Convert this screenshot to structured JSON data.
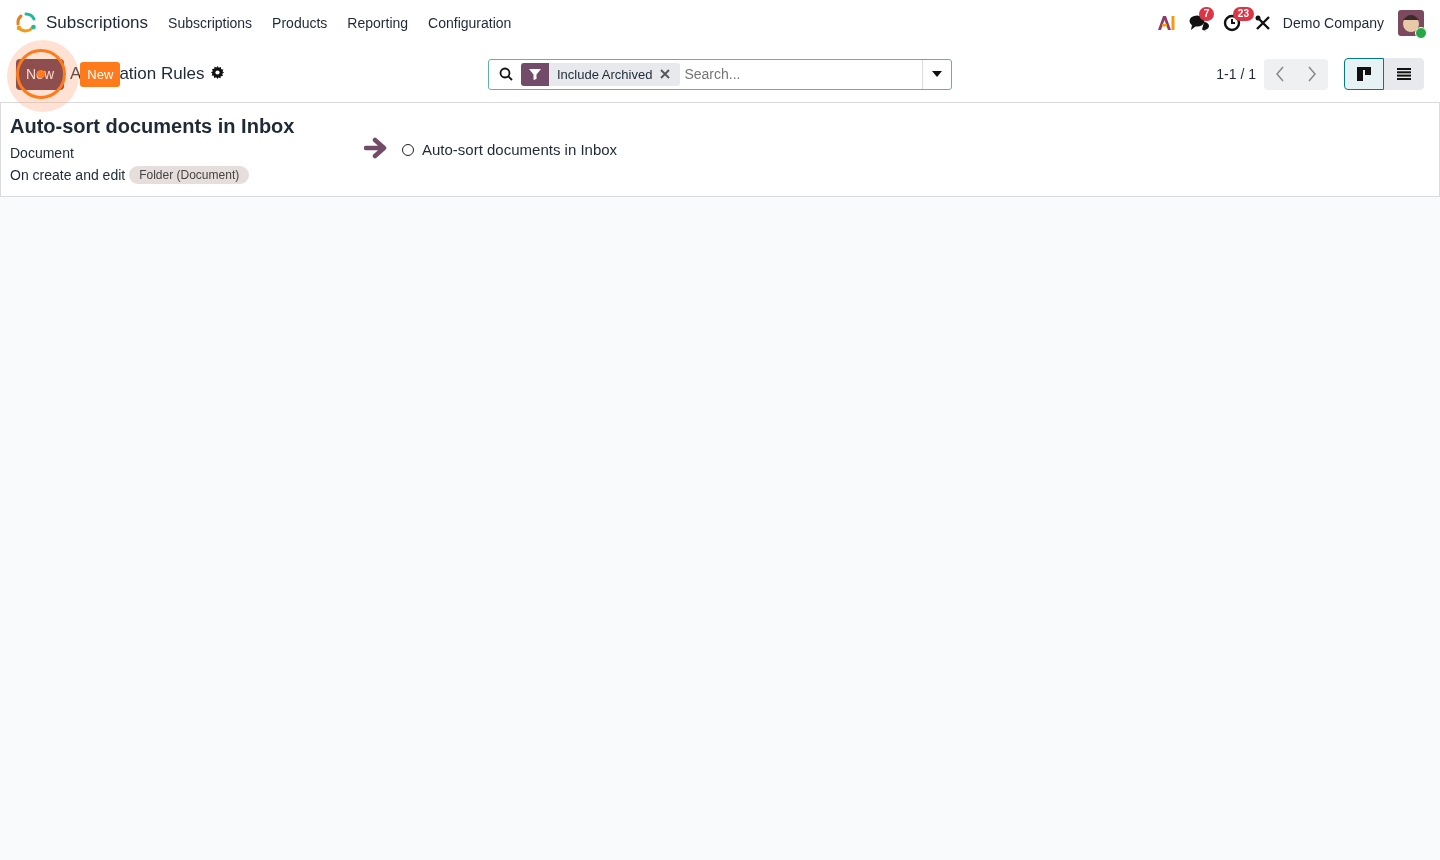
{
  "app": {
    "name": "Subscriptions"
  },
  "menu": [
    {
      "label": "Subscriptions"
    },
    {
      "label": "Products"
    },
    {
      "label": "Reporting"
    },
    {
      "label": "Configuration"
    }
  ],
  "systray": {
    "messages_count": "7",
    "activities_count": "23",
    "company": "Demo Company"
  },
  "control_panel": {
    "new_button": "New",
    "tour_tip": "New",
    "breadcrumb_parts": [
      "A",
      "ation Rules"
    ],
    "search": {
      "facets": [
        {
          "label": "Include Archived"
        }
      ],
      "placeholder": "Search..."
    },
    "pager": "1-1 / 1",
    "views": [
      {
        "kind": "kanban",
        "selected": true
      },
      {
        "kind": "list",
        "selected": false
      }
    ]
  },
  "records": [
    {
      "name": "Auto-sort documents in Inbox",
      "model": "Document",
      "trigger": "On create and edit",
      "tag": "Folder (Document)",
      "actions": [
        {
          "name": "Auto-sort documents in Inbox"
        }
      ]
    }
  ]
}
